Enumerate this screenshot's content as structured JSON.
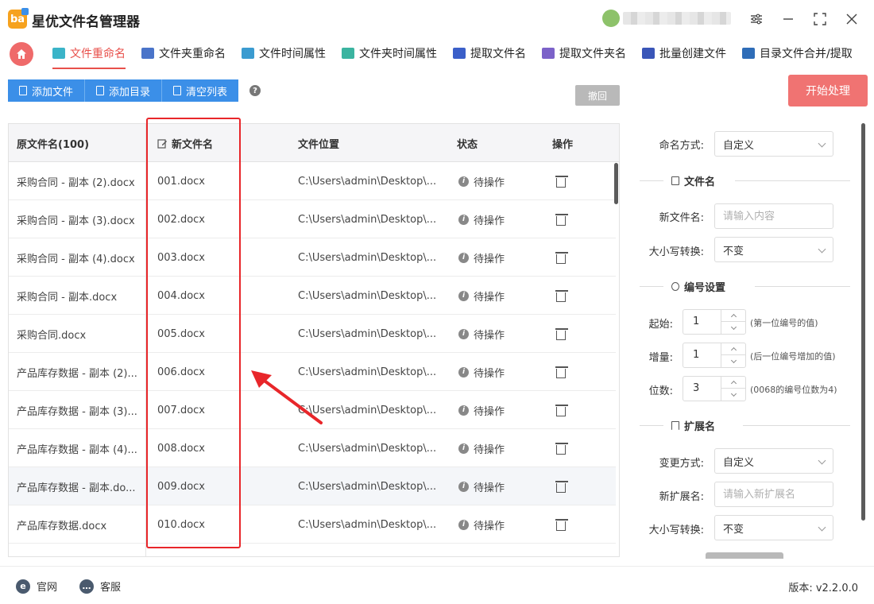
{
  "app": {
    "logo_text": "ba",
    "title": "星优文件名管理器",
    "window_controls": {
      "settings": "⚙",
      "minimize": "—",
      "maximize": "⛶",
      "close": "✕"
    }
  },
  "nav": {
    "tabs": [
      {
        "label": "文件重命名",
        "active": true,
        "icon_color": "#3bb4c8"
      },
      {
        "label": "文件夹重命名",
        "active": false,
        "icon_color": "#4a74c9"
      },
      {
        "label": "文件时间属性",
        "active": false,
        "icon_color": "#3b9bd0"
      },
      {
        "label": "文件夹时间属性",
        "active": false,
        "icon_color": "#3bb4a0"
      },
      {
        "label": "提取文件名",
        "active": false,
        "icon_color": "#3b5fc9"
      },
      {
        "label": "提取文件夹名",
        "active": false,
        "icon_color": "#7c62c9"
      },
      {
        "label": "批量创建文件",
        "active": false,
        "icon_color": "#3a56b8"
      },
      {
        "label": "目录文件合并/提取",
        "active": false,
        "icon_color": "#2f6db8"
      }
    ]
  },
  "toolbar": {
    "add_file": "添加文件",
    "add_dir": "添加目录",
    "clear_list": "清空列表",
    "help": "?",
    "undo": "撤回",
    "start": "开始处理"
  },
  "table": {
    "headers": {
      "original": "原文件名(100)",
      "new_name": "新文件名",
      "location": "文件位置",
      "status": "状态",
      "action": "操作"
    },
    "rows": [
      {
        "original": "采购合同 - 副本 (2).docx",
        "new_name": "001.docx",
        "location": "C:\\Users\\admin\\Desktop\\...",
        "status": "待操作"
      },
      {
        "original": "采购合同 - 副本 (3).docx",
        "new_name": "002.docx",
        "location": "C:\\Users\\admin\\Desktop\\...",
        "status": "待操作"
      },
      {
        "original": "采购合同 - 副本 (4).docx",
        "new_name": "003.docx",
        "location": "C:\\Users\\admin\\Desktop\\...",
        "status": "待操作"
      },
      {
        "original": "采购合同 - 副本.docx",
        "new_name": "004.docx",
        "location": "C:\\Users\\admin\\Desktop\\...",
        "status": "待操作"
      },
      {
        "original": "采购合同.docx",
        "new_name": "005.docx",
        "location": "C:\\Users\\admin\\Desktop\\...",
        "status": "待操作"
      },
      {
        "original": "产品库存数据 - 副本 (2)...",
        "new_name": "006.docx",
        "location": "C:\\Users\\admin\\Desktop\\...",
        "status": "待操作"
      },
      {
        "original": "产品库存数据 - 副本 (3)...",
        "new_name": "007.docx",
        "location": "C:\\Users\\admin\\Desktop\\...",
        "status": "待操作"
      },
      {
        "original": "产品库存数据 - 副本 (4)...",
        "new_name": "008.docx",
        "location": "C:\\Users\\admin\\Desktop\\...",
        "status": "待操作"
      },
      {
        "original": "产品库存数据 - 副本.do...",
        "new_name": "009.docx",
        "location": "C:\\Users\\admin\\Desktop\\...",
        "status": "待操作"
      },
      {
        "original": "产品库存数据.docx",
        "new_name": "010.docx",
        "location": "C:\\Users\\admin\\Desktop\\...",
        "status": "待操作"
      }
    ]
  },
  "panel": {
    "naming_mode_label": "命名方式:",
    "naming_mode_value": "自定义",
    "filename_section": "文件名",
    "new_filename_label": "新文件名:",
    "new_filename_placeholder": "请输入内容",
    "case_label": "大小写转换:",
    "case_value": "不变",
    "numbering_section": "编号设置",
    "start_label": "起始:",
    "start_value": "1",
    "start_hint": "(第一位编号的值)",
    "step_label": "增量:",
    "step_value": "1",
    "step_hint": "(后一位编号增加的值)",
    "digits_label": "位数:",
    "digits_value": "3",
    "digits_hint": "(0068的编号位数为4)",
    "ext_section": "扩展名",
    "ext_mode_label": "变更方式:",
    "ext_mode_value": "自定义",
    "new_ext_label": "新扩展名:",
    "new_ext_placeholder": "请输入新扩展名",
    "ext_case_label": "大小写转换:",
    "ext_case_value": "不变"
  },
  "footer": {
    "website": "官网",
    "support": "客服",
    "version": "版本: v2.2.0.0"
  },
  "colors": {
    "accent_red": "#e8504b",
    "toolbar_blue": "#3b8fe8",
    "start_button": "#f07372",
    "highlight_box": "#e8262a"
  }
}
